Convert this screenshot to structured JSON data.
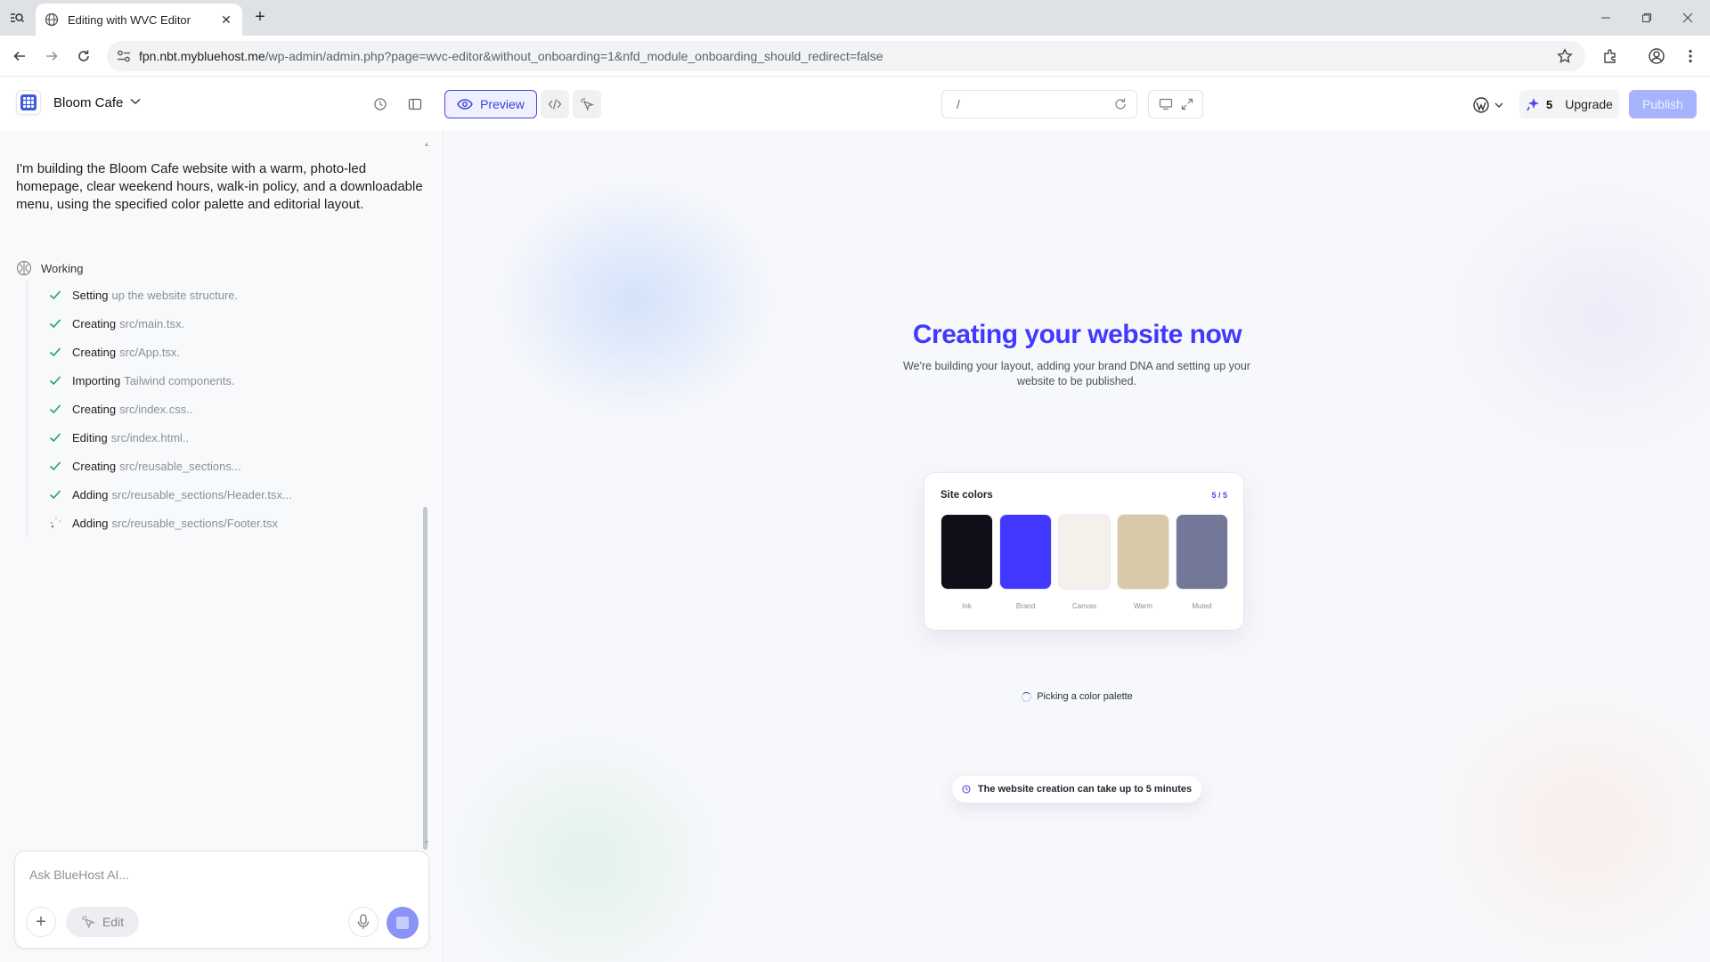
{
  "browser": {
    "tab_title": "Editing with WVC Editor",
    "url_host": "fpn.nbt.mybluehost.me",
    "url_path": "/wp-admin/admin.php?page=wvc-editor&without_onboarding=1&nfd_module_onboarding_should_redirect=false"
  },
  "appbar": {
    "site_name": "Bloom Cafe",
    "preview_label": "Preview",
    "path_value": "/",
    "credits_count": "5",
    "upgrade_label": "Upgrade",
    "publish_label": "Publish"
  },
  "chat": {
    "prompt": "I'm building the Bloom Cafe website with a warm, photo-led homepage, clear weekend hours, walk-in policy, and a downloadable menu, using the specified color palette and editorial layout.",
    "status_label": "Working",
    "steps": [
      {
        "verb": "Setting",
        "object": "up the website structure.",
        "state": "done"
      },
      {
        "verb": "Creating",
        "object": "src/main.tsx.",
        "state": "done"
      },
      {
        "verb": "Creating",
        "object": "src/App.tsx.",
        "state": "done"
      },
      {
        "verb": "Importing",
        "object": "Tailwind components.",
        "state": "done"
      },
      {
        "verb": "Creating",
        "object": "src/index.css..",
        "state": "done"
      },
      {
        "verb": "Editing",
        "object": "src/index.html..",
        "state": "done"
      },
      {
        "verb": "Creating",
        "object": "src/reusable_sections...",
        "state": "done"
      },
      {
        "verb": "Adding",
        "object": "src/reusable_sections/Header.tsx...",
        "state": "done"
      },
      {
        "verb": "Adding",
        "object": "src/reusable_sections/Footer.tsx",
        "state": "in-progress"
      }
    ],
    "input_placeholder": "Ask BlueHost AI...",
    "edit_label": "Edit"
  },
  "canvas": {
    "headline": "Creating your website now",
    "subline": "We're building your layout, adding your brand DNA and setting up your website to be published.",
    "colors_title": "Site colors",
    "colors_count": "5 / 5",
    "swatches": [
      {
        "name": "Ink",
        "color": "#0f0f1a"
      },
      {
        "name": "Brand",
        "color": "#4338ff"
      },
      {
        "name": "Canvas",
        "color": "#f4f1eb"
      },
      {
        "name": "Warm",
        "color": "#d9c9a8"
      },
      {
        "name": "Muted",
        "color": "#737898"
      }
    ],
    "progress_text": "Picking a color palette",
    "notice_text": "The website creation can take up to 5 minutes"
  }
}
